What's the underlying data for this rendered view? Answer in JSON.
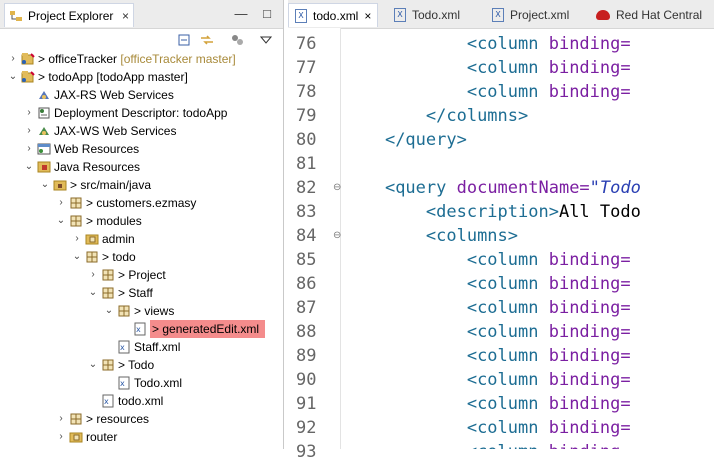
{
  "left": {
    "tab_title": "Project Explorer",
    "close_glyph": "×",
    "controls": {
      "minimize": "—",
      "maximize": "□"
    },
    "toolbar": {
      "collapse_icon": "collapse-all-icon",
      "link_icon": "link-editor-icon",
      "view_menu_icon": "view-menu-icon"
    },
    "tree": [
      {
        "level": 0,
        "twisty": "›",
        "icon": "project-icon",
        "label": "officeTracker",
        "annotation": "[officeTracker master]",
        "changed": true
      },
      {
        "level": 0,
        "twisty": "⌄",
        "icon": "project-icon",
        "label": "todoApp",
        "annotation": "[todoApp master]",
        "changed": true
      },
      {
        "level": 1,
        "twisty": "",
        "icon": "jaxrs-icon",
        "label": "JAX-RS Web Services"
      },
      {
        "level": 1,
        "twisty": "›",
        "icon": "deployment-icon",
        "label": "Deployment Descriptor: todoApp"
      },
      {
        "level": 1,
        "twisty": "›",
        "icon": "jaxws-icon",
        "label": "JAX-WS Web Services"
      },
      {
        "level": 1,
        "twisty": "›",
        "icon": "web-resources-icon",
        "label": "Web Resources"
      },
      {
        "level": 1,
        "twisty": "⌄",
        "icon": "java-resources-icon",
        "label": "Java Resources"
      },
      {
        "level": 2,
        "twisty": "⌄",
        "icon": "source-folder-icon",
        "label": "src/main/java",
        "changed": true
      },
      {
        "level": 3,
        "twisty": "›",
        "icon": "package-icon",
        "label": "customers.ezmasy",
        "changed": true
      },
      {
        "level": 3,
        "twisty": "⌄",
        "icon": "package-icon",
        "label": "modules",
        "changed": true
      },
      {
        "level": 4,
        "twisty": "›",
        "icon": "package-folder-icon",
        "label": "admin"
      },
      {
        "level": 4,
        "twisty": "⌄",
        "icon": "package-icon",
        "label": "todo",
        "changed": true
      },
      {
        "level": 5,
        "twisty": "›",
        "icon": "package-icon",
        "label": "Project",
        "changed": true
      },
      {
        "level": 5,
        "twisty": "⌄",
        "icon": "package-icon",
        "label": "Staff",
        "changed": true
      },
      {
        "level": 6,
        "twisty": "⌄",
        "icon": "package-icon",
        "label": "views",
        "changed": true
      },
      {
        "level": 7,
        "twisty": "",
        "icon": "xml-file-icon",
        "label": "generatedEdit.xml",
        "selected": true,
        "changed": true
      },
      {
        "level": 6,
        "twisty": "",
        "icon": "xml-file-icon",
        "label": "Staff.xml"
      },
      {
        "level": 5,
        "twisty": "⌄",
        "icon": "package-icon",
        "label": "Todo",
        "changed": true
      },
      {
        "level": 6,
        "twisty": "",
        "icon": "xml-file-icon",
        "label": "Todo.xml"
      },
      {
        "level": 5,
        "twisty": "",
        "icon": "xml-file-icon",
        "label": "todo.xml"
      },
      {
        "level": 3,
        "twisty": "›",
        "icon": "package-icon",
        "label": "resources",
        "changed": true
      },
      {
        "level": 3,
        "twisty": "›",
        "icon": "package-folder-icon",
        "label": "router"
      }
    ]
  },
  "editor": {
    "tabs": [
      {
        "name": "tab-todo-xml",
        "label": "todo.xml",
        "icon": "xml-file-icon",
        "active": true,
        "close": "×"
      },
      {
        "name": "tab-todo-xml-2",
        "label": "Todo.xml",
        "icon": "xml-file-icon",
        "active": false
      },
      {
        "name": "tab-project-xml",
        "label": "Project.xml",
        "icon": "xml-file-icon",
        "active": false
      },
      {
        "name": "tab-red-hat-central",
        "label": "Red Hat Central",
        "icon": "redhat-icon",
        "active": false
      }
    ],
    "lines": [
      {
        "n": "76",
        "fold": "",
        "indent": "            ",
        "t": [
          {
            "c": "tag",
            "v": "<column "
          },
          {
            "c": "attr",
            "v": "binding="
          }
        ]
      },
      {
        "n": "77",
        "fold": "",
        "indent": "            ",
        "t": [
          {
            "c": "tag",
            "v": "<column "
          },
          {
            "c": "attr",
            "v": "binding="
          }
        ]
      },
      {
        "n": "78",
        "fold": "",
        "indent": "            ",
        "t": [
          {
            "c": "tag",
            "v": "<column "
          },
          {
            "c": "attr",
            "v": "binding="
          }
        ]
      },
      {
        "n": "79",
        "fold": "",
        "indent": "        ",
        "t": [
          {
            "c": "tag",
            "v": "</columns>"
          }
        ]
      },
      {
        "n": "80",
        "fold": "",
        "indent": "    ",
        "t": [
          {
            "c": "tag",
            "v": "</query>"
          }
        ]
      },
      {
        "n": "81",
        "fold": "",
        "indent": "",
        "t": []
      },
      {
        "n": "82",
        "fold": "⊖",
        "indent": "    ",
        "t": [
          {
            "c": "tag",
            "v": "<query "
          },
          {
            "c": "attr",
            "v": "documentName="
          },
          {
            "c": "str",
            "v": "\"Todo"
          }
        ]
      },
      {
        "n": "83",
        "fold": "",
        "indent": "        ",
        "t": [
          {
            "c": "tag",
            "v": "<description>"
          },
          {
            "c": "txt",
            "v": "All Todo"
          }
        ]
      },
      {
        "n": "84",
        "fold": "⊖",
        "indent": "        ",
        "t": [
          {
            "c": "tag",
            "v": "<columns>"
          }
        ]
      },
      {
        "n": "85",
        "fold": "",
        "indent": "            ",
        "t": [
          {
            "c": "tag",
            "v": "<column "
          },
          {
            "c": "attr",
            "v": "binding="
          }
        ]
      },
      {
        "n": "86",
        "fold": "",
        "indent": "            ",
        "t": [
          {
            "c": "tag",
            "v": "<column "
          },
          {
            "c": "attr",
            "v": "binding="
          }
        ]
      },
      {
        "n": "87",
        "fold": "",
        "indent": "            ",
        "t": [
          {
            "c": "tag",
            "v": "<column "
          },
          {
            "c": "attr",
            "v": "binding="
          }
        ]
      },
      {
        "n": "88",
        "fold": "",
        "indent": "            ",
        "t": [
          {
            "c": "tag",
            "v": "<column "
          },
          {
            "c": "attr",
            "v": "binding="
          }
        ]
      },
      {
        "n": "89",
        "fold": "",
        "indent": "            ",
        "t": [
          {
            "c": "tag",
            "v": "<column "
          },
          {
            "c": "attr",
            "v": "binding="
          }
        ]
      },
      {
        "n": "90",
        "fold": "",
        "indent": "            ",
        "t": [
          {
            "c": "tag",
            "v": "<column "
          },
          {
            "c": "attr",
            "v": "binding="
          }
        ]
      },
      {
        "n": "91",
        "fold": "",
        "indent": "            ",
        "t": [
          {
            "c": "tag",
            "v": "<column "
          },
          {
            "c": "attr",
            "v": "binding="
          }
        ]
      },
      {
        "n": "92",
        "fold": "",
        "indent": "            ",
        "t": [
          {
            "c": "tag",
            "v": "<column "
          },
          {
            "c": "attr",
            "v": "binding="
          }
        ]
      },
      {
        "n": "93",
        "fold": "",
        "indent": "            ",
        "t": [
          {
            "c": "tag",
            "v": "<column "
          },
          {
            "c": "attr",
            "v": "binding="
          }
        ]
      }
    ]
  }
}
